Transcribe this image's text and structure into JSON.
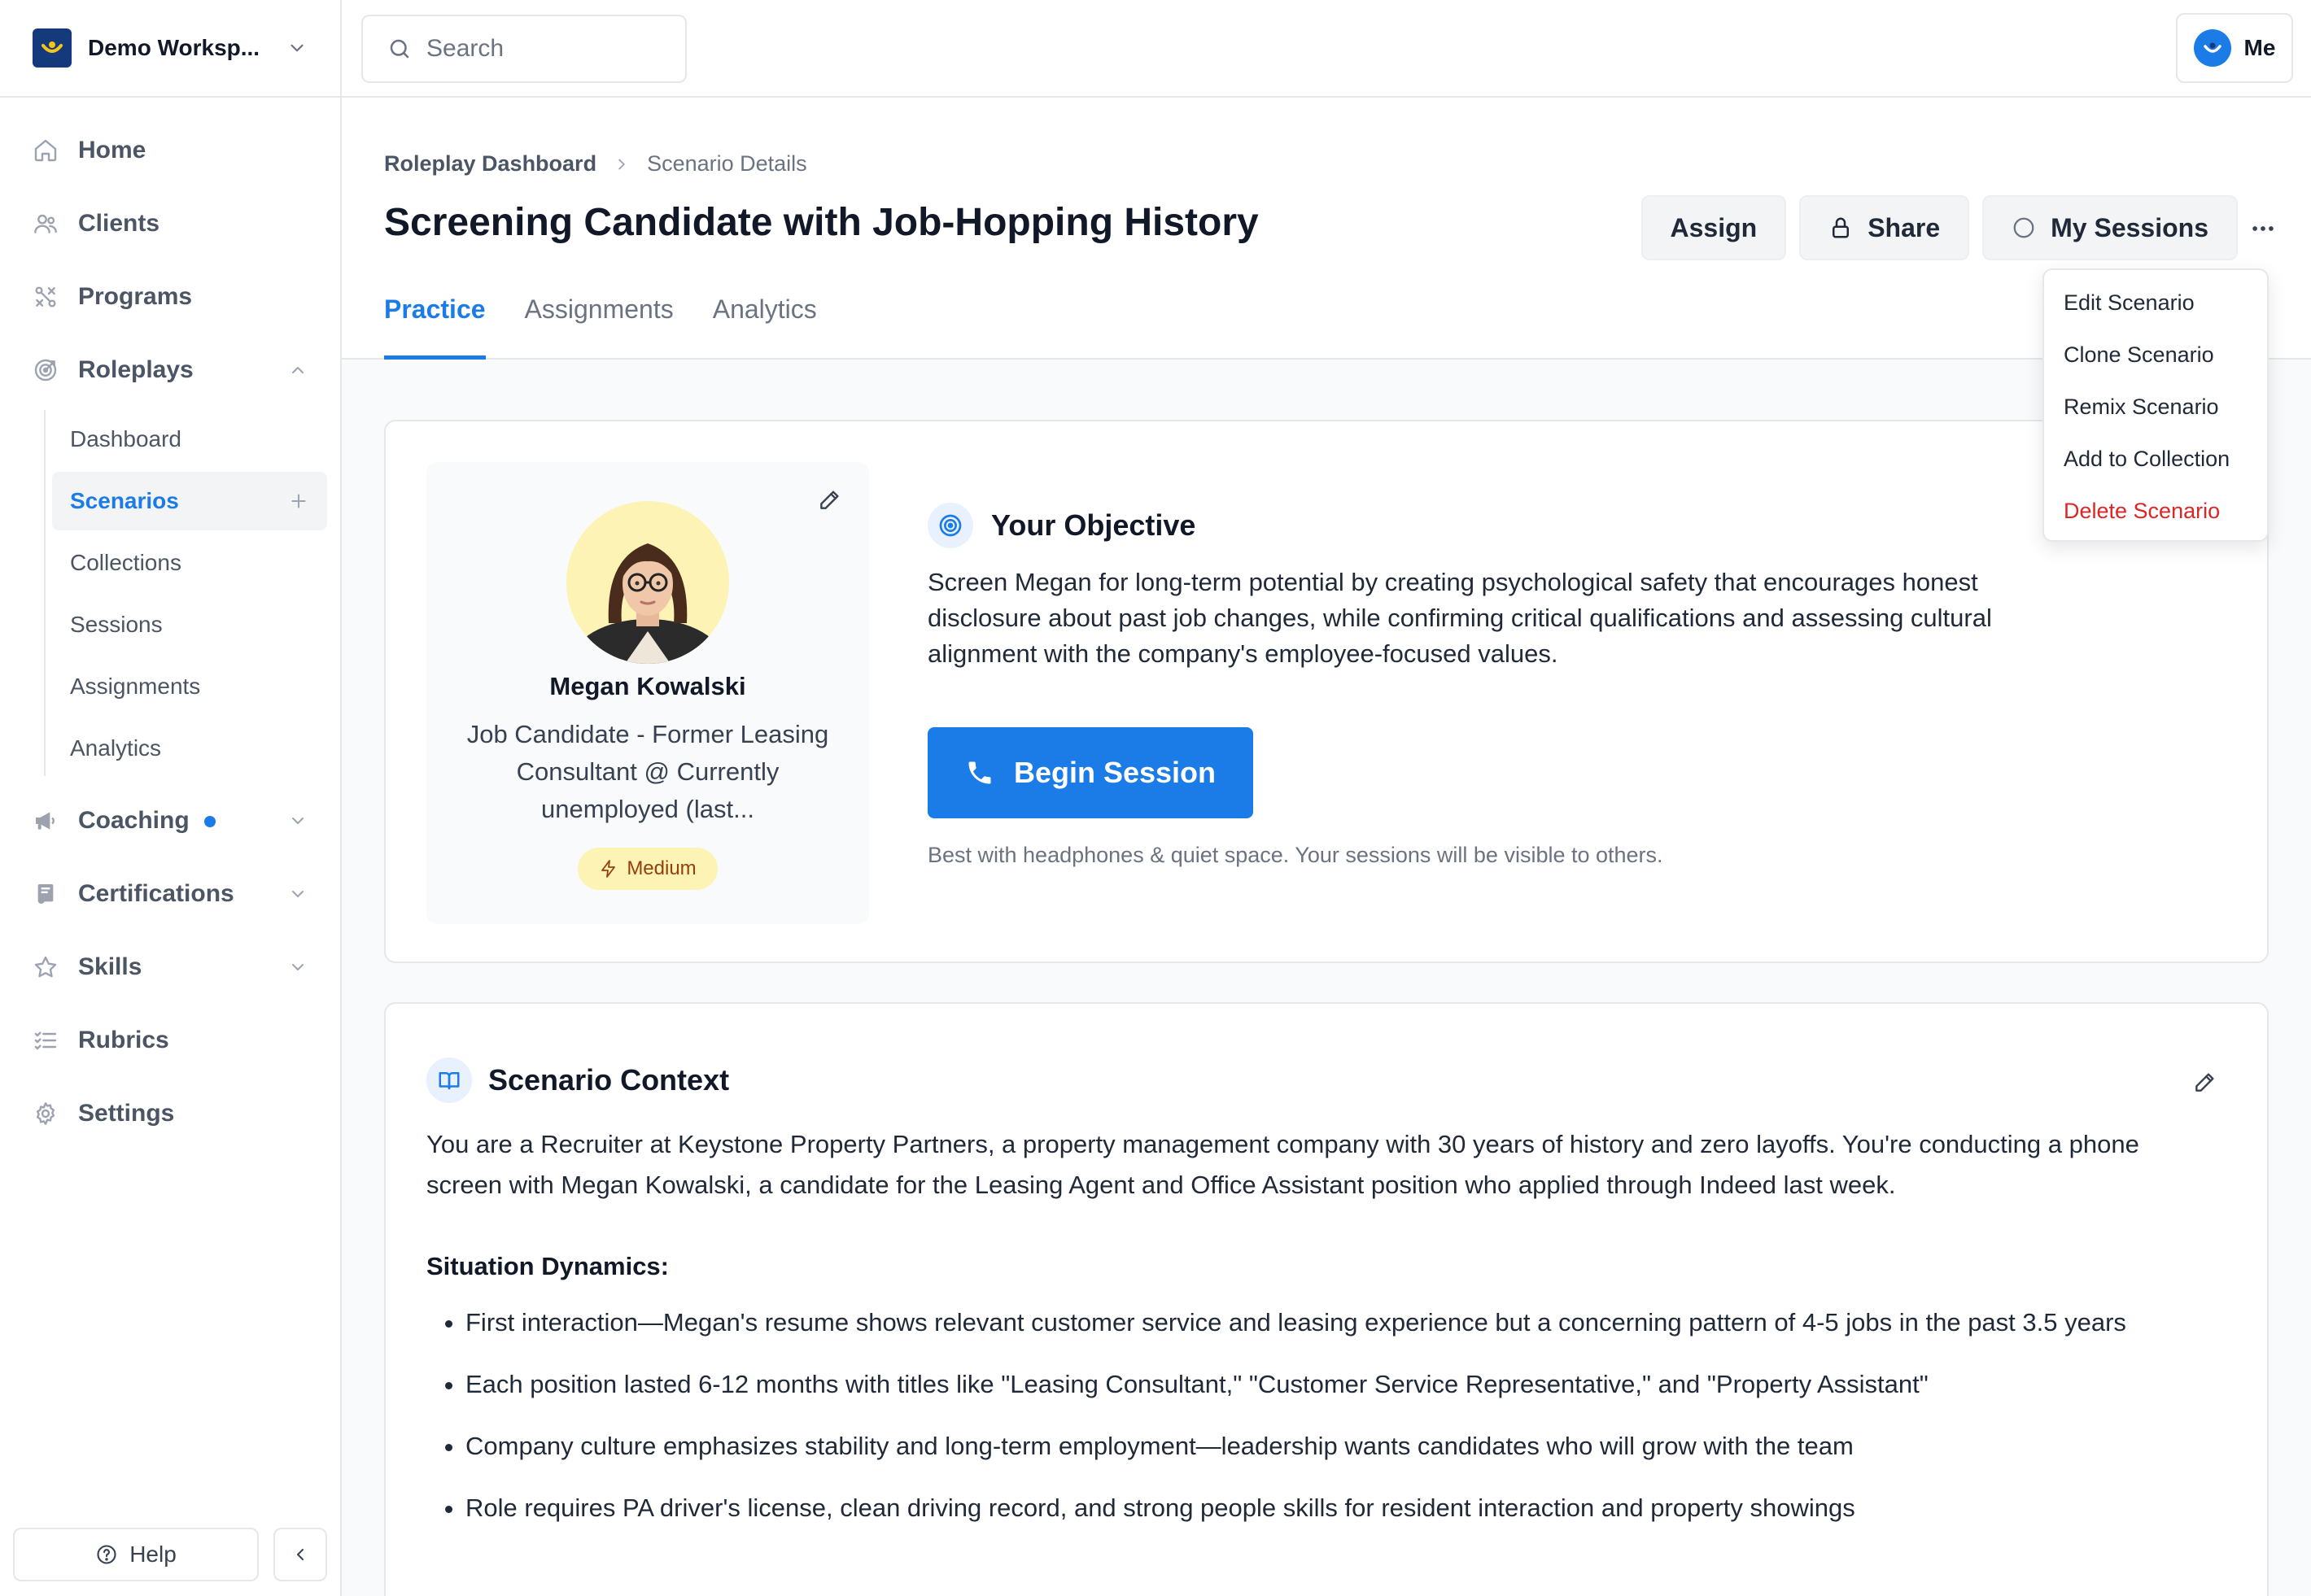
{
  "workspace": {
    "name": "Demo Worksp..."
  },
  "search": {
    "placeholder": "Search"
  },
  "user": {
    "label": "Me"
  },
  "sidebar": {
    "items": [
      {
        "label": "Home",
        "icon": "home-icon"
      },
      {
        "label": "Clients",
        "icon": "users-icon"
      },
      {
        "label": "Programs",
        "icon": "programs-icon"
      },
      {
        "label": "Roleplays",
        "icon": "target-icon",
        "expanded": true
      },
      {
        "label": "Coaching",
        "icon": "megaphone-icon",
        "has_dot": true
      },
      {
        "label": "Certifications",
        "icon": "certificate-icon"
      },
      {
        "label": "Skills",
        "icon": "star-icon"
      },
      {
        "label": "Rubrics",
        "icon": "checklist-icon"
      },
      {
        "label": "Settings",
        "icon": "gear-icon"
      }
    ],
    "roleplay_sub": [
      {
        "label": "Dashboard"
      },
      {
        "label": "Scenarios",
        "active": true
      },
      {
        "label": "Collections"
      },
      {
        "label": "Sessions"
      },
      {
        "label": "Assignments"
      },
      {
        "label": "Analytics"
      }
    ],
    "help_label": "Help"
  },
  "breadcrumb": {
    "parent": "Roleplay Dashboard",
    "current": "Scenario Details"
  },
  "page": {
    "title": "Screening Candidate with Job-Hopping History"
  },
  "actions": {
    "assign": "Assign",
    "share": "Share",
    "my_sessions": "My Sessions"
  },
  "tabs": [
    {
      "label": "Practice",
      "active": true
    },
    {
      "label": "Assignments"
    },
    {
      "label": "Analytics"
    }
  ],
  "menu": {
    "items": [
      {
        "label": "Edit Scenario"
      },
      {
        "label": "Clone Scenario"
      },
      {
        "label": "Remix Scenario"
      },
      {
        "label": "Add to Collection"
      },
      {
        "label": "Delete Scenario",
        "danger": true
      }
    ]
  },
  "persona": {
    "name": "Megan Kowalski",
    "role": "Job Candidate - Former Leasing Consultant @ Currently unemployed (last...",
    "difficulty": "Medium"
  },
  "objective": {
    "title": "Your Objective",
    "text": "Screen Megan for long-term potential by creating psychological safety that encourages honest disclosure about past job changes, while confirming critical qualifications and assessing cultural alignment with the company's employee-focused values.",
    "button": "Begin Session",
    "hint": "Best with headphones & quiet space. Your sessions will be visible to others."
  },
  "context": {
    "title": "Scenario Context",
    "intro": "You are a Recruiter at Keystone Property Partners, a property management company with 30 years of history and zero layoffs. You're conducting a phone screen with Megan Kowalski, a candidate for the Leasing Agent and Office Assistant position who applied through Indeed last week.",
    "subheading": "Situation Dynamics:",
    "bullets": [
      "First interaction—Megan's resume shows relevant customer service and leasing experience but a concerning pattern of 4-5 jobs in the past 3.5 years",
      "Each position lasted 6-12 months with titles like \"Leasing Consultant,\" \"Customer Service Representative,\" and \"Property Assistant\"",
      "Company culture emphasizes stability and long-term employment—leadership wants candidates who will grow with the team",
      "Role requires PA driver's license, clean driving record, and strong people skills for resident interaction and property showings"
    ]
  },
  "colors": {
    "accent": "#1b7ce8",
    "brand": "#143a7b",
    "danger": "#dc2626",
    "badge_bg": "#fdf3b4"
  }
}
